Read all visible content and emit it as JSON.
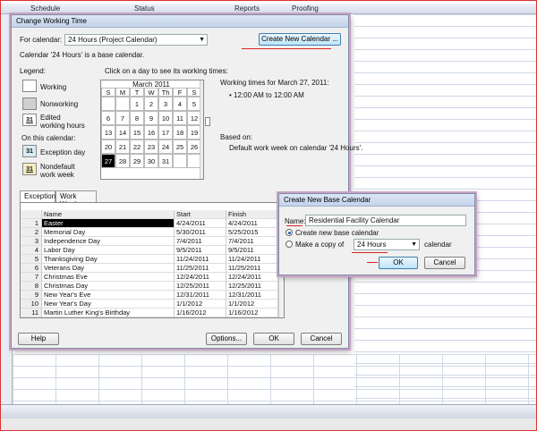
{
  "background": {
    "menu": [
      "Schedule",
      "Status",
      "Reports",
      "Proofing"
    ]
  },
  "working_time_dialog": {
    "title": "Change Working Time",
    "for_calendar_label": "For calendar:",
    "for_calendar_value": "24 Hours (Project Calendar)",
    "create_new_button": "Create New Calendar ...",
    "base_note": "Calendar '24 Hours' is a base calendar.",
    "legend_title": "Legend:",
    "legend_working": "Working",
    "legend_nonworking": "Nonworking",
    "legend_edited": "Edited working hours",
    "on_this_calendar": "On this calendar:",
    "legend_exception": "Exception day",
    "legend_nondefault": "Nondefault work week",
    "swatch_number": "31",
    "click_hint": "Click on a day to see its working times:",
    "calendar_month": "March 2011",
    "weekdays": [
      "S",
      "M",
      "T",
      "W",
      "Th",
      "F",
      "S"
    ],
    "days": [
      "",
      "",
      "1",
      "2",
      "3",
      "4",
      "5",
      "6",
      "7",
      "8",
      "9",
      "10",
      "11",
      "12",
      "13",
      "14",
      "15",
      "16",
      "17",
      "18",
      "19",
      "20",
      "21",
      "22",
      "23",
      "24",
      "25",
      "26",
      "27",
      "28",
      "29",
      "30",
      "31",
      "",
      ""
    ],
    "selected_day": "27",
    "working_times_title": "Working times for March 27, 2011:",
    "working_times_item": "• 12:00 AM to 12:00 AM",
    "based_on_label": "Based on:",
    "based_on_text": "Default work week on calendar '24 Hours'.",
    "tabs": [
      "Exceptions",
      "Work Weeks"
    ],
    "table_headers": [
      "",
      "Name",
      "Start",
      "Finish"
    ],
    "exceptions": [
      {
        "n": "1",
        "name": "Easter",
        "start": "4/24/2011",
        "finish": "4/24/2011"
      },
      {
        "n": "2",
        "name": "Memorial Day",
        "start": "5/30/2011",
        "finish": "5/25/2015"
      },
      {
        "n": "3",
        "name": "Independence Day",
        "start": "7/4/2011",
        "finish": "7/4/2011"
      },
      {
        "n": "4",
        "name": "Labor Day",
        "start": "9/5/2011",
        "finish": "9/5/2011"
      },
      {
        "n": "5",
        "name": "Thanksgiving Day",
        "start": "11/24/2011",
        "finish": "11/24/2011"
      },
      {
        "n": "6",
        "name": "Veterans Day",
        "start": "11/25/2011",
        "finish": "11/25/2011"
      },
      {
        "n": "7",
        "name": "Christmas Eve",
        "start": "12/24/2011",
        "finish": "12/24/2011"
      },
      {
        "n": "8",
        "name": "Christmas Day",
        "start": "12/25/2011",
        "finish": "12/25/2011"
      },
      {
        "n": "9",
        "name": "New Year's Eve",
        "start": "12/31/2011",
        "finish": "12/31/2011"
      },
      {
        "n": "10",
        "name": "New Year's Day",
        "start": "1/1/2012",
        "finish": "1/1/2012"
      },
      {
        "n": "11",
        "name": "Martin Luther King's Birthday",
        "start": "1/16/2012",
        "finish": "1/16/2012"
      }
    ],
    "help_button": "Help",
    "options_button": "Options...",
    "ok_button": "OK",
    "cancel_button": "Cancel"
  },
  "new_calendar_dialog": {
    "title": "Create New Base Calendar",
    "name_label": "Name:",
    "name_value": "Residential Facility Calendar",
    "radio_create": "Create new base calendar",
    "radio_copy": "Make a copy of",
    "copy_value": "24 Hours",
    "copy_suffix": "calendar",
    "ok_button": "OK",
    "cancel_button": "Cancel"
  },
  "colors": {
    "annotation_red": "#dd2222",
    "dialog_glow": "#c9a1c6"
  }
}
